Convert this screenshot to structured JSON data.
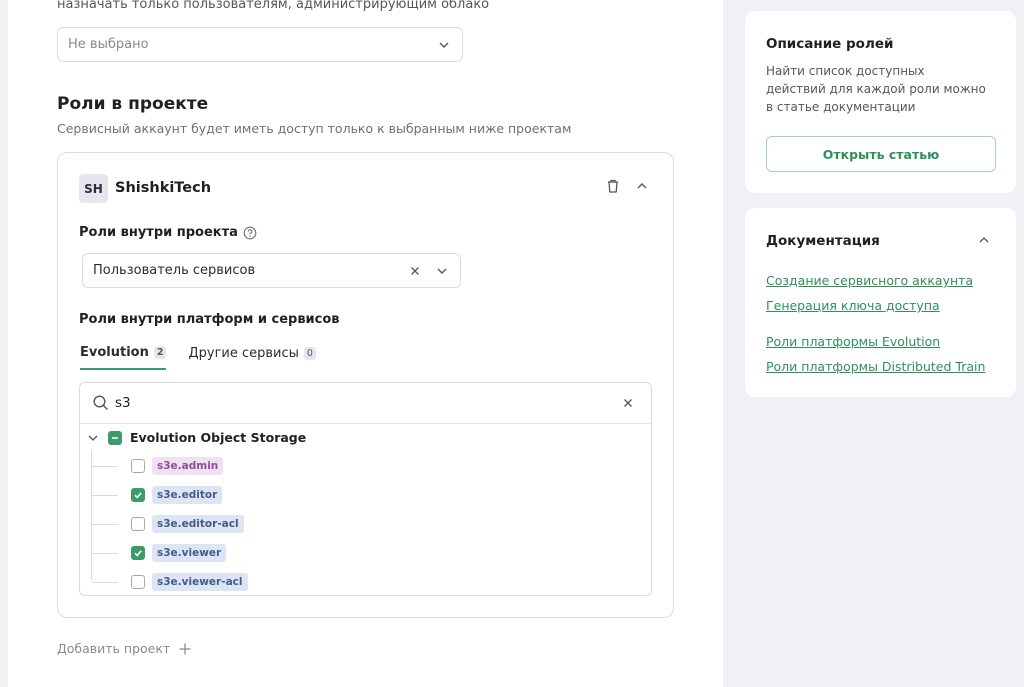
{
  "top_hint": "назначать только пользователям, администрирующим облако",
  "admin_select": {
    "placeholder": "Не выбрано"
  },
  "project_roles": {
    "title": "Роли в проекте",
    "description": "Сервисный аккаунт будет иметь доступ только к выбранным ниже проектам"
  },
  "project": {
    "initials": "SH",
    "name": "ShishkiTech",
    "roles_label": "Роли внутри проекта",
    "roles_value": "Пользователь сервисов",
    "platform_roles_label": "Роли внутри платформ и сервисов",
    "tabs": [
      {
        "label": "Evolution",
        "count": "2",
        "active": true
      },
      {
        "label": "Другие сервисы",
        "count": "0",
        "active": false
      }
    ],
    "search_value": "s3",
    "tree": {
      "group_label": "Evolution Object Storage",
      "items": [
        {
          "label": "s3e.admin",
          "checked": false,
          "color": "purple"
        },
        {
          "label": "s3e.editor",
          "checked": true,
          "color": "blue"
        },
        {
          "label": "s3e.editor-acl",
          "checked": false,
          "color": "blue"
        },
        {
          "label": "s3e.viewer",
          "checked": true,
          "color": "blue"
        },
        {
          "label": "s3e.viewer-acl",
          "checked": false,
          "color": "blue"
        }
      ]
    }
  },
  "add_project_label": "Добавить проект",
  "roles_description": {
    "title": "Описание ролей",
    "text": "Найти список доступных действий для каждой роли можно в статье документации",
    "button": "Открыть статью"
  },
  "documentation": {
    "title": "Документация",
    "links": [
      "Создание сервисного аккаунта",
      "Генерация ключа доступа",
      "Роли платформы Evolution",
      "Роли платформы Distributed Train"
    ]
  },
  "colors": {
    "accent": "#3d9b6b",
    "link": "#2f8f5d"
  }
}
